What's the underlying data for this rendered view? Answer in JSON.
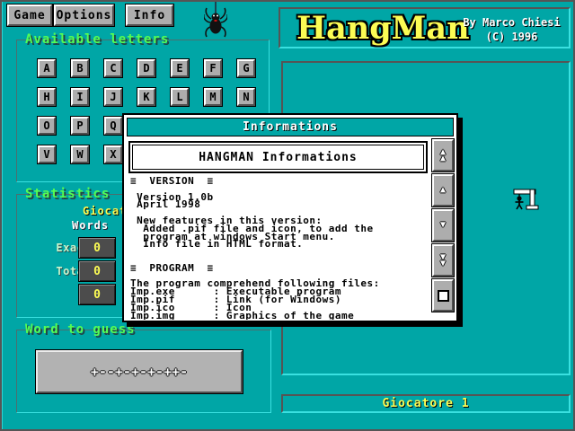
{
  "app": {
    "title": "HangMan",
    "byline": "By Marco Chiesi",
    "copyright": "(C) 1996"
  },
  "menu": {
    "items": [
      "Game",
      "Options",
      "Info"
    ]
  },
  "panels": {
    "available_letters": {
      "title": "Available letters",
      "letters": "ABCDEFGHIJKLMNOPQRSTUVWXYZ"
    },
    "statistics": {
      "title": "Statistics",
      "player_header": "Giocatore 1",
      "columns_header": "Words  Letters",
      "rows": [
        {
          "label": "Exact",
          "value": "0"
        },
        {
          "label": "Total",
          "value": "0"
        },
        {
          "label": "%",
          "value": "0"
        }
      ]
    },
    "word_to_guess": {
      "title": "Word to guess",
      "pattern": "+--+-+-+-++-"
    },
    "player_bar": {
      "label": "Giocatore 1"
    }
  },
  "dialog": {
    "title": "Informations",
    "header": "HANGMAN Informations",
    "body_lines": [
      "≡  VERSION  ≡",
      "",
      " Version 1.0b",
      " April 1998",
      "",
      " New features in this version:",
      "  Added .pif file and icon, to add the",
      "  program at windows Start menu.",
      "  Info file in HTML format.",
      "",
      "",
      "≡  PROGRAM  ≡",
      "",
      "The program comprehend following files:",
      "Imp.exe      : Executable program",
      "Imp.pif      : Link (for Windows)",
      "Imp.ico      : Icon",
      "Imp.img      : Graphics of the game"
    ],
    "scrollbar": [
      "double-up",
      "up",
      "down",
      "double-down",
      "stop"
    ]
  },
  "icons": [
    "spider-icon",
    "gallows-icon"
  ],
  "colors": {
    "background_teal": "#00a6a6",
    "highlight_cyan": "#3ae0e0",
    "shadow_gray": "#555555",
    "button_gray": "#adadad",
    "label_green": "#54fc54",
    "accent_yellow": "#fcfc54",
    "lcd_dark": "#4c4c4c"
  }
}
